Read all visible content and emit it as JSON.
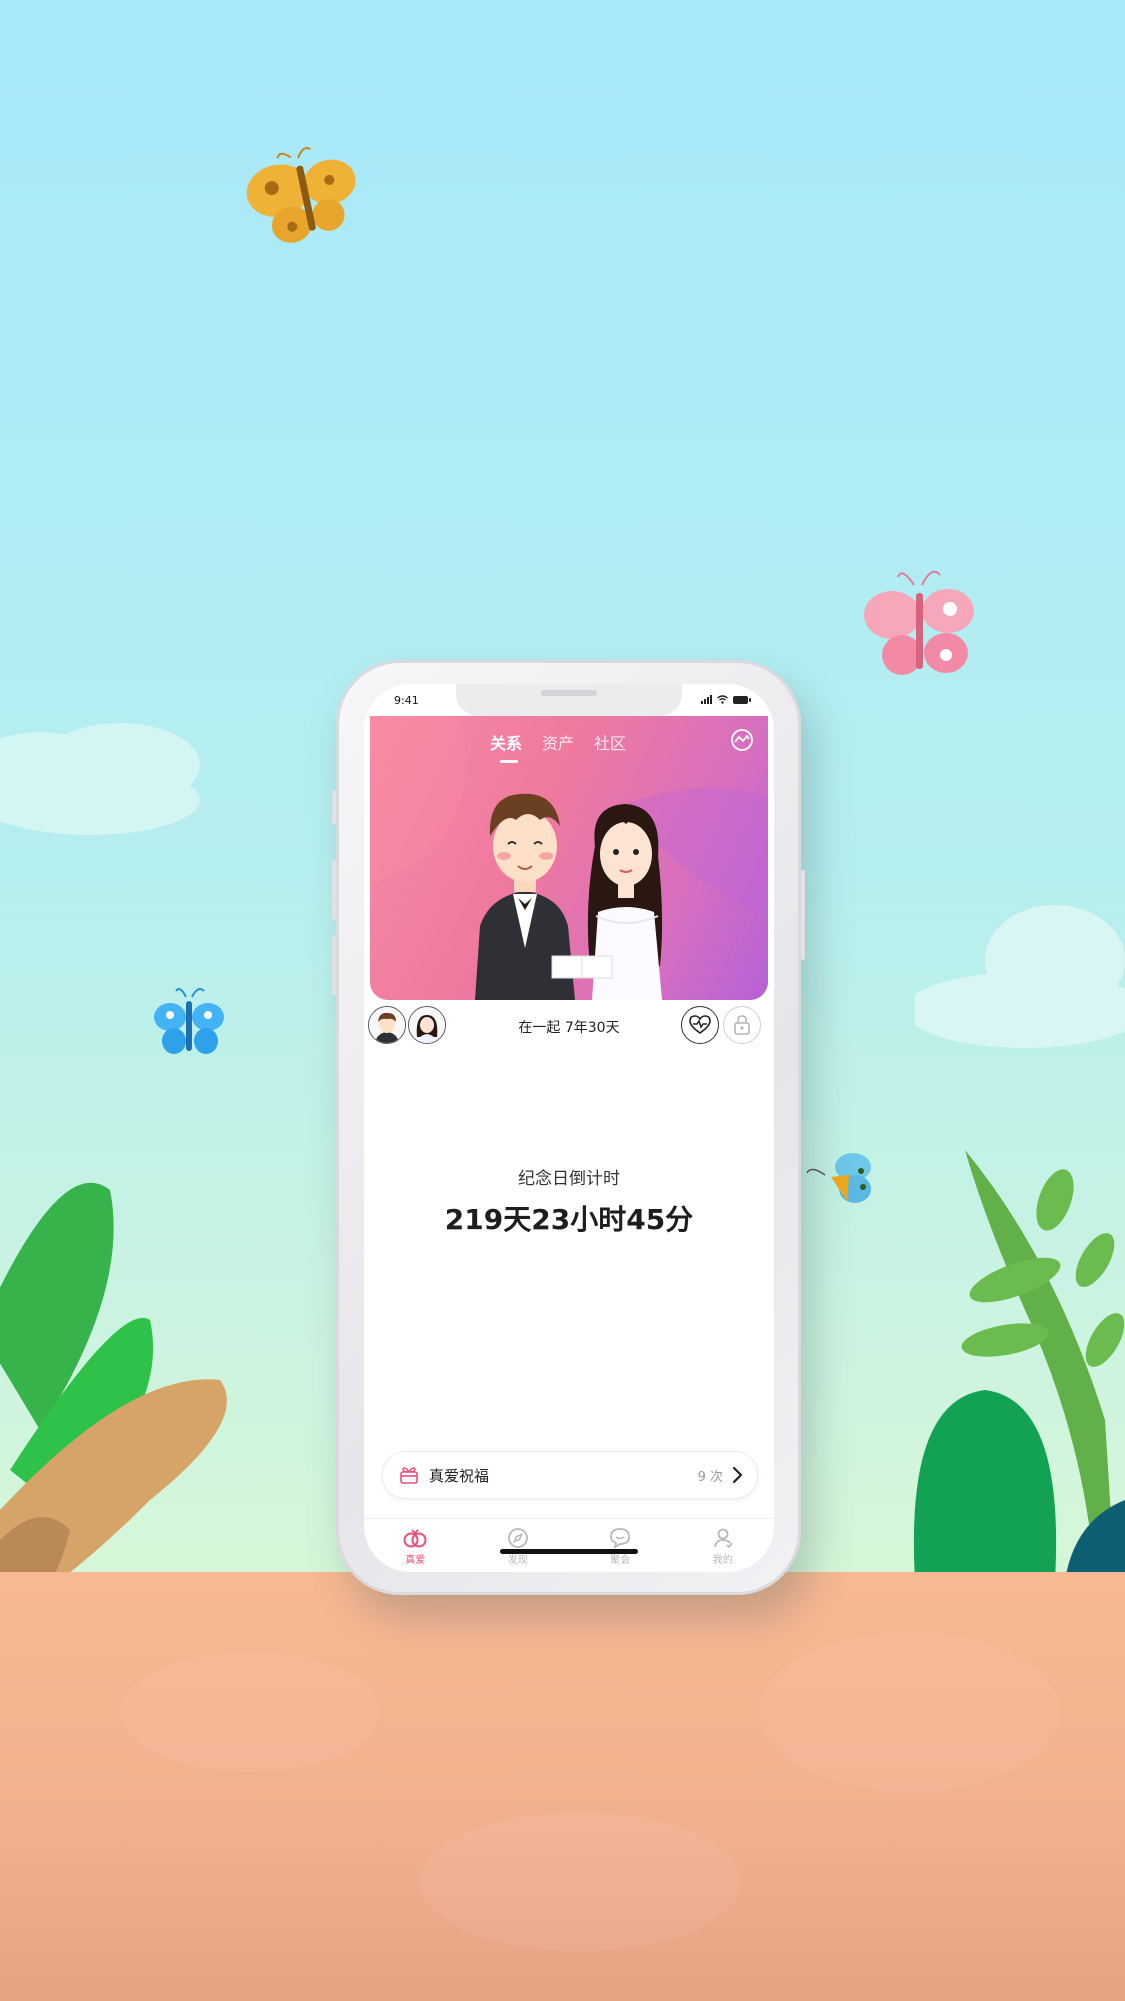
{
  "status_bar": {
    "time": "9:41"
  },
  "header": {
    "tabs": [
      {
        "label": "关系",
        "active": true
      },
      {
        "label": "资产",
        "active": false
      },
      {
        "label": "社区",
        "active": false
      }
    ],
    "action_icon": "chart-circle-icon"
  },
  "relationship": {
    "together_text": "在一起 7年30天"
  },
  "countdown": {
    "label": "纪念日倒计时",
    "value": "219天23小时45分"
  },
  "blessing": {
    "label": "真爱祝福",
    "count": "9 次"
  },
  "tabbar": {
    "items": [
      {
        "label": "真爱",
        "icon": "rings-icon",
        "active": true
      },
      {
        "label": "发现",
        "icon": "compass-icon",
        "active": false
      },
      {
        "label": "聚会",
        "icon": "chat-bubble-icon",
        "active": false
      },
      {
        "label": "我的",
        "icon": "profile-icon",
        "active": false
      }
    ]
  },
  "colors": {
    "accent": "#ec4c79",
    "hero_gradient_start": "#f58aa6",
    "hero_gradient_end": "#b661d8",
    "sky_top": "#a8e8fb",
    "ground": "#f8b893"
  }
}
